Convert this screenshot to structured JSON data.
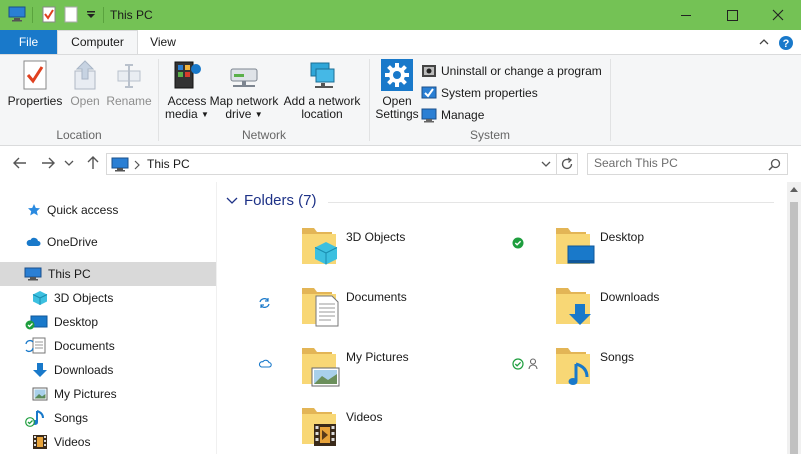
{
  "window": {
    "title": "This PC",
    "accent": "#74c255",
    "controls": [
      "minimize-icon",
      "maximize-icon",
      "close-icon"
    ]
  },
  "quick_access_toolbar": {
    "icons": [
      "computer-icon",
      "properties-icon",
      "new-folder-icon",
      "customize-dropdown-icon"
    ]
  },
  "ribbon": {
    "tabs": [
      {
        "label": "File",
        "active": false
      },
      {
        "label": "Computer",
        "active": true
      },
      {
        "label": "View",
        "active": false
      }
    ],
    "groups": {
      "location": {
        "label": "Location",
        "buttons": [
          {
            "label": "Properties",
            "enabled": true
          },
          {
            "label": "Open",
            "enabled": false
          },
          {
            "label": "Rename",
            "enabled": false
          }
        ]
      },
      "network": {
        "label": "Network",
        "buttons": [
          {
            "line1": "Access",
            "line2": "media"
          },
          {
            "line1": "Map network",
            "line2": "drive"
          },
          {
            "line1": "Add a network",
            "line2": "location"
          }
        ]
      },
      "system": {
        "label": "System",
        "open_settings": {
          "line1": "Open",
          "line2": "Settings"
        },
        "items": [
          {
            "label": "Uninstall or change a program"
          },
          {
            "label": "System properties"
          },
          {
            "label": "Manage"
          }
        ]
      }
    }
  },
  "address_bar": {
    "path": "This PC",
    "search_placeholder": "Search This PC"
  },
  "nav_pane": {
    "items": [
      {
        "label": "Quick access",
        "icon": "star-icon",
        "level": 1,
        "selected": false
      },
      {
        "label": "OneDrive",
        "icon": "cloud-icon",
        "level": 1,
        "selected": false
      },
      {
        "label": "This PC",
        "icon": "computer-icon",
        "level": 1,
        "selected": true
      },
      {
        "label": "3D Objects",
        "icon": "cube-icon",
        "level": 2,
        "selected": false
      },
      {
        "label": "Desktop",
        "icon": "desktop-icon",
        "level": 2,
        "selected": false
      },
      {
        "label": "Documents",
        "icon": "documents-icon",
        "level": 2,
        "selected": false
      },
      {
        "label": "Downloads",
        "icon": "download-icon",
        "level": 2,
        "selected": false
      },
      {
        "label": "My Pictures",
        "icon": "pictures-icon",
        "level": 2,
        "selected": false
      },
      {
        "label": "Songs",
        "icon": "music-icon",
        "level": 2,
        "selected": false
      },
      {
        "label": "Videos",
        "icon": "video-icon",
        "level": 2,
        "selected": false
      }
    ]
  },
  "content": {
    "group_title": "Folders (7)",
    "folders": [
      {
        "name": "3D Objects",
        "overlay": "cube",
        "status": ""
      },
      {
        "name": "Desktop",
        "overlay": "desktop",
        "status": "synced"
      },
      {
        "name": "Documents",
        "overlay": "document",
        "status": "syncing"
      },
      {
        "name": "Downloads",
        "overlay": "download",
        "status": ""
      },
      {
        "name": "My Pictures",
        "overlay": "picture",
        "status": "cloud-only"
      },
      {
        "name": "Songs",
        "overlay": "music",
        "status": "synced-shared"
      },
      {
        "name": "Videos",
        "overlay": "video",
        "status": ""
      }
    ]
  }
}
